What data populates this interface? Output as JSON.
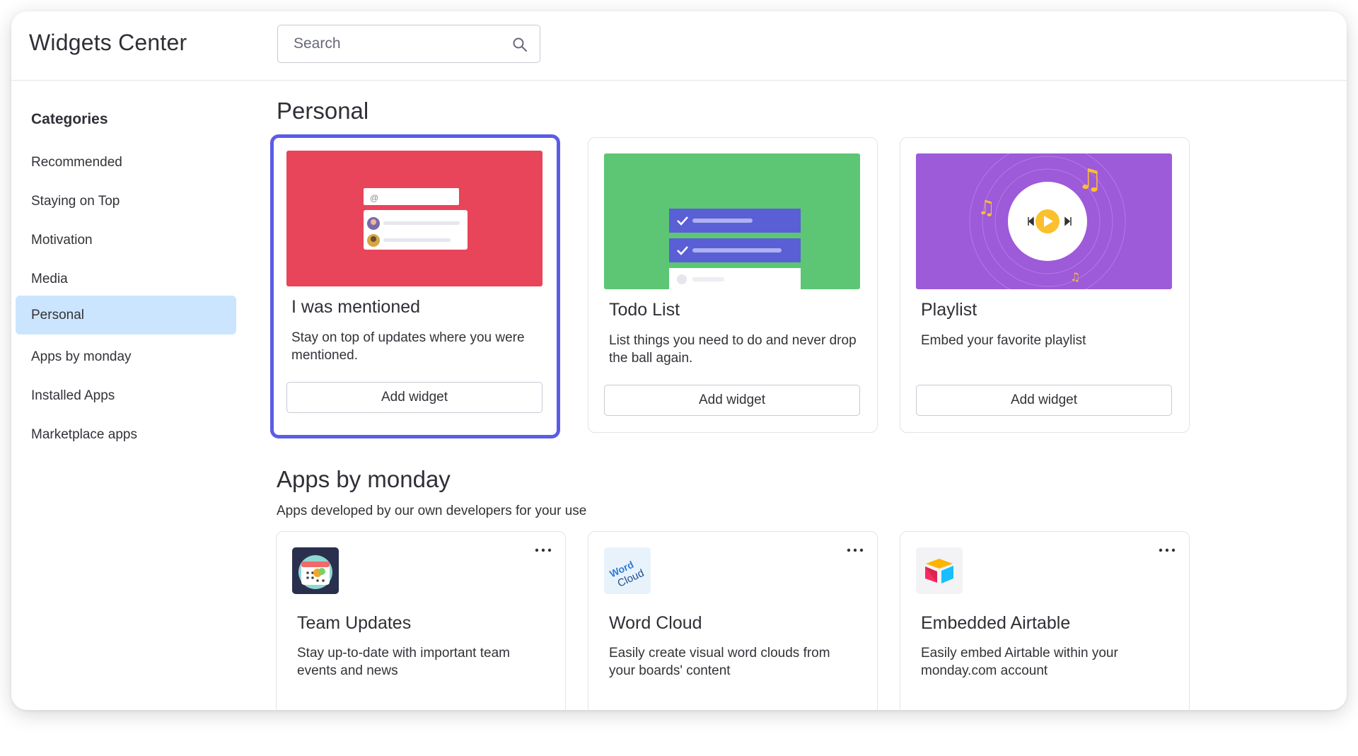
{
  "header": {
    "title": "Widgets Center",
    "search_placeholder": "Search"
  },
  "sidebar": {
    "title": "Categories",
    "items": [
      {
        "label": "Recommended"
      },
      {
        "label": "Staying on Top"
      },
      {
        "label": "Motivation"
      },
      {
        "label": "Media"
      },
      {
        "label": "Personal",
        "active": true
      },
      {
        "label": "Apps by monday"
      },
      {
        "label": "Installed Apps"
      },
      {
        "label": "Marketplace apps"
      }
    ]
  },
  "sections": {
    "personal": {
      "title": "Personal",
      "cards": [
        {
          "title": "I was mentioned",
          "description": "Stay on top of updates where you were mentioned.",
          "button": "Add widget",
          "selected": true
        },
        {
          "title": "Todo List",
          "description": "List things you need to do and never drop the ball again.",
          "button": "Add widget"
        },
        {
          "title": "Playlist",
          "description": "Embed your favorite playlist",
          "button": "Add widget"
        }
      ]
    },
    "apps": {
      "title": "Apps by monday",
      "subtitle": "Apps developed by our own developers for your use",
      "cards": [
        {
          "title": "Team Updates",
          "description": "Stay up-to-date with important team events and news",
          "icon": "calendar-chat-icon"
        },
        {
          "title": "Word Cloud",
          "description": "Easily create visual word clouds from your boards' content",
          "icon": "word-cloud-icon",
          "icon_text": [
            "Word",
            "Cloud"
          ]
        },
        {
          "title": "Embedded Airtable",
          "description": "Easily embed Airtable within your monday.com account",
          "icon": "airtable-icon"
        }
      ]
    }
  },
  "colors": {
    "selected_border": "#5b5ce6",
    "active_category": "#cce5ff",
    "mention_bg": "#e8445a",
    "todo_bg": "#5cc674",
    "playlist_bg": "#9d5ad9",
    "accent_yellow": "#fbc02d"
  }
}
